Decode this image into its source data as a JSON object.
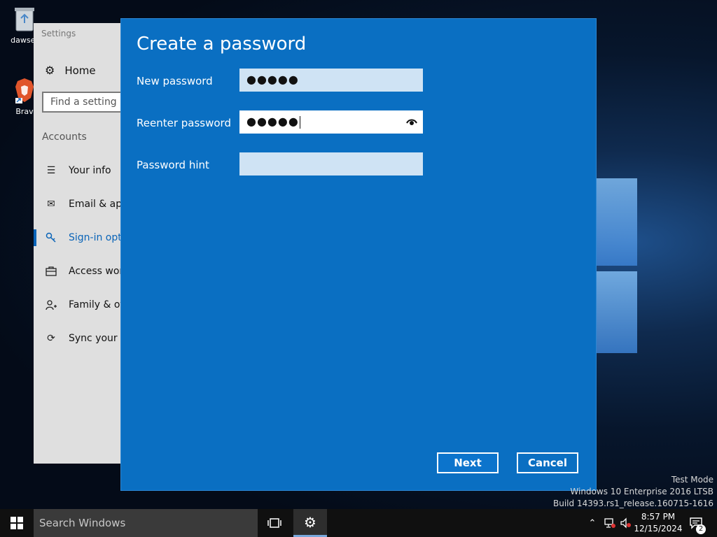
{
  "desktop": {
    "icons": [
      {
        "label": "dawser",
        "icon": "recycle-bin-icon"
      },
      {
        "label": "Brav",
        "icon": "brave-browser-icon"
      }
    ],
    "watermark": {
      "line1": "Test Mode",
      "line2": "Windows 10 Enterprise 2016 LTSB",
      "line3": "Build 14393.rs1_release.160715-1616"
    }
  },
  "settings": {
    "title": "Settings",
    "home_label": "Home",
    "search_placeholder": "Find a setting",
    "section": "Accounts",
    "nav": [
      {
        "label": "Your info",
        "icon": "person-list-icon"
      },
      {
        "label": "Email & app",
        "icon": "envelope-icon"
      },
      {
        "label": "Sign-in opti",
        "icon": "key-icon",
        "active": true
      },
      {
        "label": "Access work",
        "icon": "briefcase-icon"
      },
      {
        "label": "Family & oth",
        "icon": "person-add-icon"
      },
      {
        "label": "Sync your se",
        "icon": "sync-icon"
      }
    ]
  },
  "dialog": {
    "title": "Create a password",
    "fields": [
      {
        "label": "New password",
        "value": "●●●●●"
      },
      {
        "label": "Reenter password",
        "value": "●●●●●"
      },
      {
        "label": "Password hint",
        "value": ""
      }
    ],
    "next_label": "Next",
    "cancel_label": "Cancel"
  },
  "taskbar": {
    "search_placeholder": "Search Windows",
    "time": "8:57 PM",
    "date": "12/15/2024",
    "notification_count": "2"
  },
  "colors": {
    "dialog_bg": "#0a6fc2",
    "accent": "#0a64b8",
    "taskbar_bg": "#101010"
  }
}
